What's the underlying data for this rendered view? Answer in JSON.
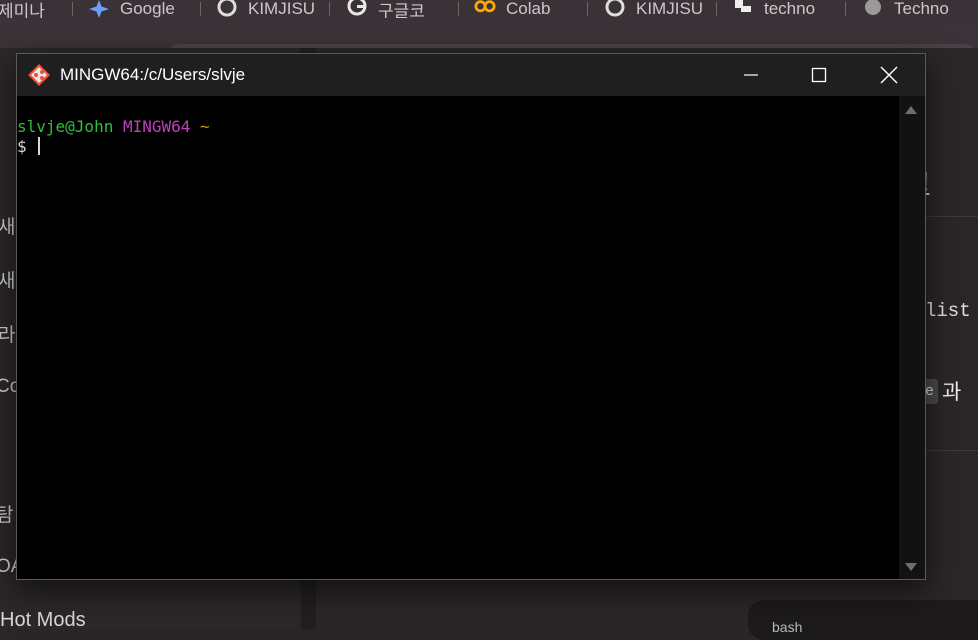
{
  "browser": {
    "tabs": [
      {
        "label": "제미나",
        "icon": "none"
      },
      {
        "label": "Google",
        "icon": "gemini-star-icon"
      },
      {
        "label": "KIMJISU",
        "icon": "github-icon"
      },
      {
        "label": "구글코",
        "icon": "google-icon"
      },
      {
        "label": "Colab",
        "icon": "colab-icon"
      },
      {
        "label": "KIMJISU",
        "icon": "github-icon"
      },
      {
        "label": "techno",
        "icon": "site-icon"
      },
      {
        "label": "Techno",
        "icon": "globe-icon"
      }
    ]
  },
  "background_page": {
    "left_labels": [
      "새",
      "새",
      "라",
      "Co",
      "탐",
      "OA"
    ],
    "hot_mods": "Hot Mods",
    "right_heading_fragment": "!",
    "right_list_fragment": "list",
    "right_code_fragment": "me",
    "right_text_fragment": "과",
    "bash_label": "bash"
  },
  "window": {
    "title": "MINGW64:/c/Users/slvje",
    "minimize_label": "—",
    "maximize_label": "☐",
    "close_label": "✕"
  },
  "terminal": {
    "user_host": "slvje@John",
    "system": "MINGW64",
    "path": "~",
    "prompt": "$ ",
    "colors": {
      "user_host": "#2fbf3a",
      "system": "#bf3fbf",
      "path": "#c0a000",
      "prompt": "#d8d8d8"
    }
  }
}
